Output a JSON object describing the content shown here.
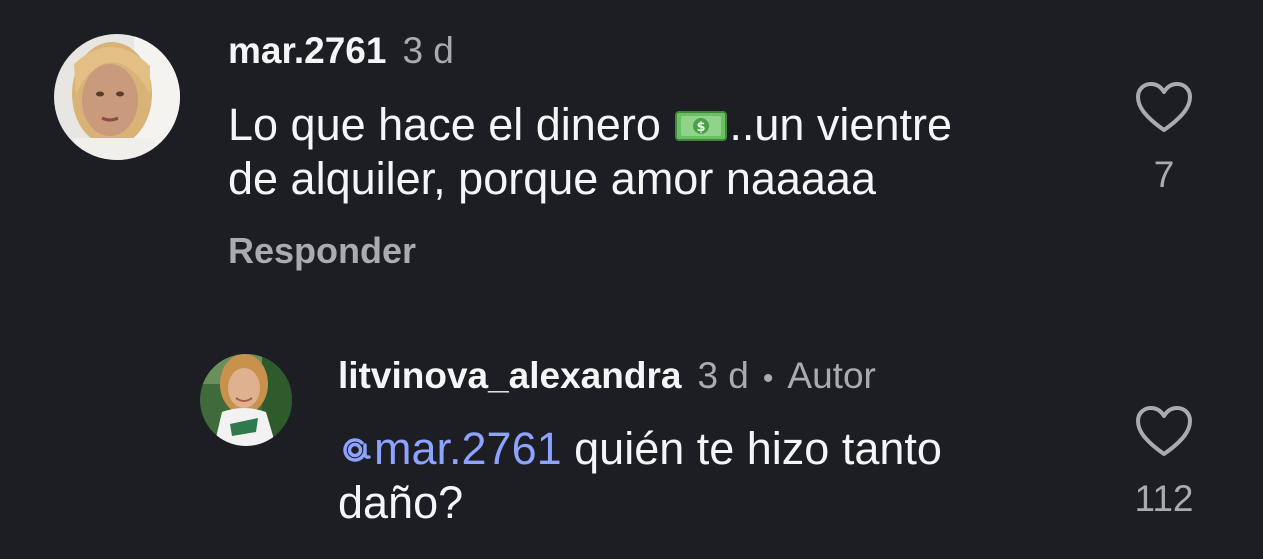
{
  "comments": [
    {
      "username": "mar.2761",
      "time": "3 d",
      "text_before": "Lo que hace el dinero",
      "text_after": "..un vientre",
      "text_line2": "de alquiler, porque amor naaaaa",
      "reply_label": "Responder",
      "likes": "7"
    },
    {
      "username": "litvinova_alexandra",
      "time": "3 d",
      "separator": "•",
      "author_tag": "Autor",
      "mention": "mar.2761",
      "text": "quién te hizo tanto",
      "text_line2": "daño?",
      "likes": "112"
    }
  ],
  "colors": {
    "background": "#1c1e23",
    "primary_text": "#f3f5f7",
    "secondary_text": "#a8abb2",
    "mention": "#8ea2ff"
  }
}
